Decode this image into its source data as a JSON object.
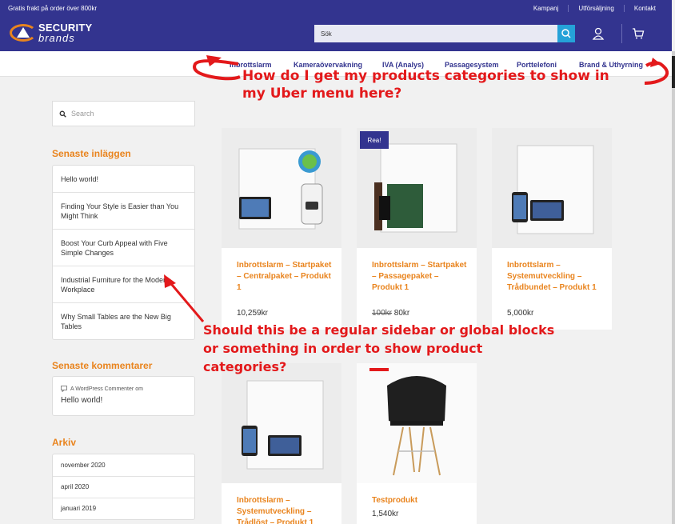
{
  "topbar": {
    "promo": "Gratis frakt på order över 800kr",
    "links": [
      "Kampanj",
      "Utförsäljning",
      "Kontakt"
    ]
  },
  "brand": {
    "line1": "SECURITY",
    "line2": "brands"
  },
  "search": {
    "value": "Sök"
  },
  "nav": {
    "items": [
      "Inbrottslarm",
      "Kameraövervakning",
      "IVA (Analys)",
      "Passagesystem",
      "Porttelefoni",
      "Brand & Uthyrning"
    ]
  },
  "annotations": {
    "menu_question": "How do I get my products categories to show in my Uber menu here?",
    "sidebar_question": "Should this be a regular sidebar or global blocks or something in order to show product categories?"
  },
  "sidebar": {
    "search_placeholder": "Search",
    "recent_posts_title": "Senaste inläggen",
    "recent_posts": [
      "Hello world!",
      "Finding Your Style is Easier than You Might Think",
      "Boost Your Curb Appeal with Five Simple Changes",
      "Industrial Furniture for the Modern Workplace",
      "Why Small Tables are the New Big Tables"
    ],
    "recent_comments_title": "Senaste kommentarer",
    "comment_author": "A WordPress Commenter",
    "comment_on": "om",
    "comment_post": "Hello world!",
    "archive_title": "Arkiv",
    "archive": [
      "november 2020",
      "april 2020",
      "januari 2019"
    ]
  },
  "products": [
    {
      "name": "Inbrottslarm – Startpaket – Centralpaket – Produkt 1",
      "price": "10,259kr",
      "old_price": "",
      "badge": ""
    },
    {
      "name": "Inbrottslarm – Startpaket – Passagepaket – Produkt 1",
      "price": "80kr",
      "old_price": "100kr",
      "badge": "Rea!"
    },
    {
      "name": "Inbrottslarm – Systemutveckling – Trådbundet – Produkt 1",
      "price": "5,000kr",
      "old_price": "",
      "badge": ""
    },
    {
      "name": "Inbrottslarm – Systemutveckling – Trådlöst – Produkt 1",
      "price": "",
      "old_price": "",
      "badge": ""
    },
    {
      "name": "Testprodukt",
      "price": "1,540kr",
      "old_price": "",
      "badge": ""
    }
  ],
  "colors": {
    "brand_blue": "#33348f",
    "accent_orange": "#e9841e",
    "search_blue": "#25a2d8",
    "annotation_red": "#e3191b"
  }
}
